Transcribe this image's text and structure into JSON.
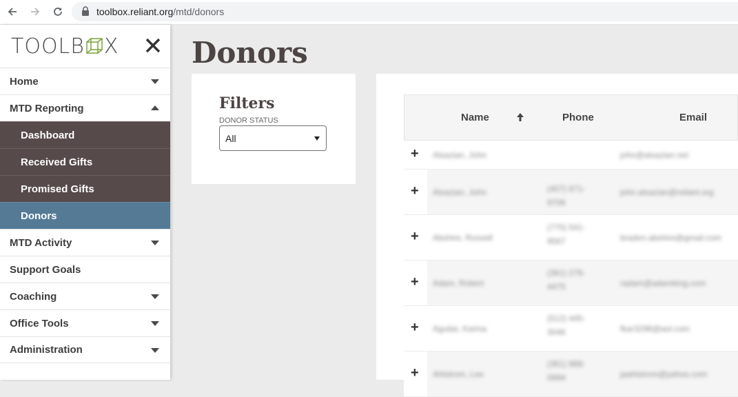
{
  "browser": {
    "url_host": "toolbox.reliant.org",
    "url_path": "/mtd/donors"
  },
  "sidebar": {
    "logo_text": "TOOLBOX",
    "items": [
      {
        "label": "Home",
        "type": "top",
        "caret": "down"
      },
      {
        "label": "MTD Reporting",
        "type": "top",
        "caret": "up"
      },
      {
        "label": "Dashboard",
        "type": "sub"
      },
      {
        "label": "Received Gifts",
        "type": "sub"
      },
      {
        "label": "Promised Gifts",
        "type": "sub"
      },
      {
        "label": "Donors",
        "type": "sub",
        "active": true
      },
      {
        "label": "MTD Activity",
        "type": "top",
        "caret": "down"
      },
      {
        "label": "Support Goals",
        "type": "top"
      },
      {
        "label": "Coaching",
        "type": "top",
        "caret": "down"
      },
      {
        "label": "Office Tools",
        "type": "top",
        "caret": "down"
      },
      {
        "label": "Administration",
        "type": "top",
        "caret": "down"
      }
    ]
  },
  "main": {
    "title": "Donors",
    "filters": {
      "heading": "Filters",
      "donor_status_label": "DONOR STATUS",
      "donor_status_value": "All"
    },
    "table": {
      "columns": [
        "Name",
        "Phone",
        "Email"
      ],
      "rows": [
        {
          "name": "Alsazian, John",
          "phone": "",
          "email": "john@alsazian.net"
        },
        {
          "name": "Alsazian, John",
          "phone": "(407) 671-9706",
          "email": "john.alsazian@reliant.org"
        },
        {
          "name": "Abshire, Russell",
          "phone": "(770) 541-9567",
          "email": "braden.abshire@gmail.com"
        },
        {
          "name": "Adam, Robert",
          "phone": "(361) 276-4475",
          "email": "radam@adamking.com"
        },
        {
          "name": "Aguilar, Karina",
          "phone": "(512) 445-3046",
          "email": "fkar3298@aol.com"
        },
        {
          "name": "Ahlstrom, Lee",
          "phone": "(361) 888-0994",
          "email": "jaahlstrom@yahoo.com"
        }
      ]
    }
  },
  "colors": {
    "submenu_bg": "#574a4b",
    "active_bg": "#547a96",
    "title_text": "#4d4444"
  }
}
